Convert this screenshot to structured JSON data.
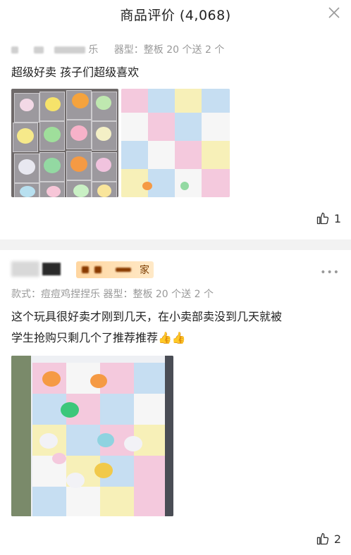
{
  "header": {
    "title": "商品评价 (4,068)"
  },
  "reviews": [
    {
      "meta": "器型：整板 20 个送 2 个",
      "name_fragment": "乐",
      "text": "超级好卖 孩子们超级喜欢",
      "likes": "1"
    },
    {
      "badge_text": "家",
      "meta": "款式：痘痘鸡捏捏乐   器型：整板 20 个送 2 个",
      "text_line1": "这个玩具很好卖才刚到几天，在小卖部卖没到几天就被",
      "text_line2": "学生抢购只剩几个了推荐推荐👍👍",
      "likes": "2"
    }
  ],
  "colors": {
    "accent_badge": "#ffd6a0",
    "divider": "#f2f2f2"
  }
}
